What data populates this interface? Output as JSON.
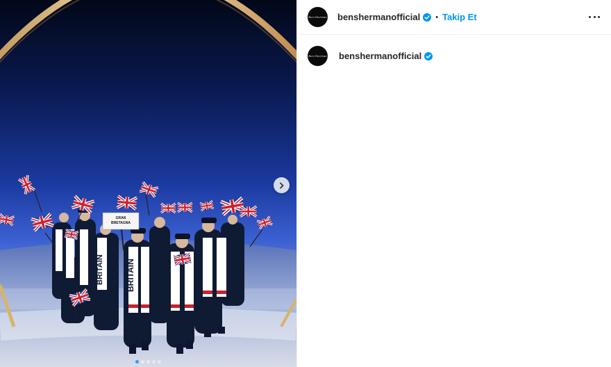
{
  "post": {
    "account": {
      "avatar_text": "Ben Sherman",
      "username": "benshermanofficial",
      "verified": true
    },
    "follow_separator": "•",
    "follow_label": "Takip Et",
    "more_icon": "more-horizontal-icon",
    "next_icon": "chevron-right-icon",
    "carousel": {
      "slide_count": 5,
      "active_index": 0
    },
    "photo": {
      "sign_text_line1": "GRAN",
      "sign_text_line2": "BRETAGNA",
      "scarf_text": "BRITAIN"
    },
    "colors": {
      "accent": "#0095f6",
      "verified": "#0095f6",
      "text": "#262626"
    }
  }
}
